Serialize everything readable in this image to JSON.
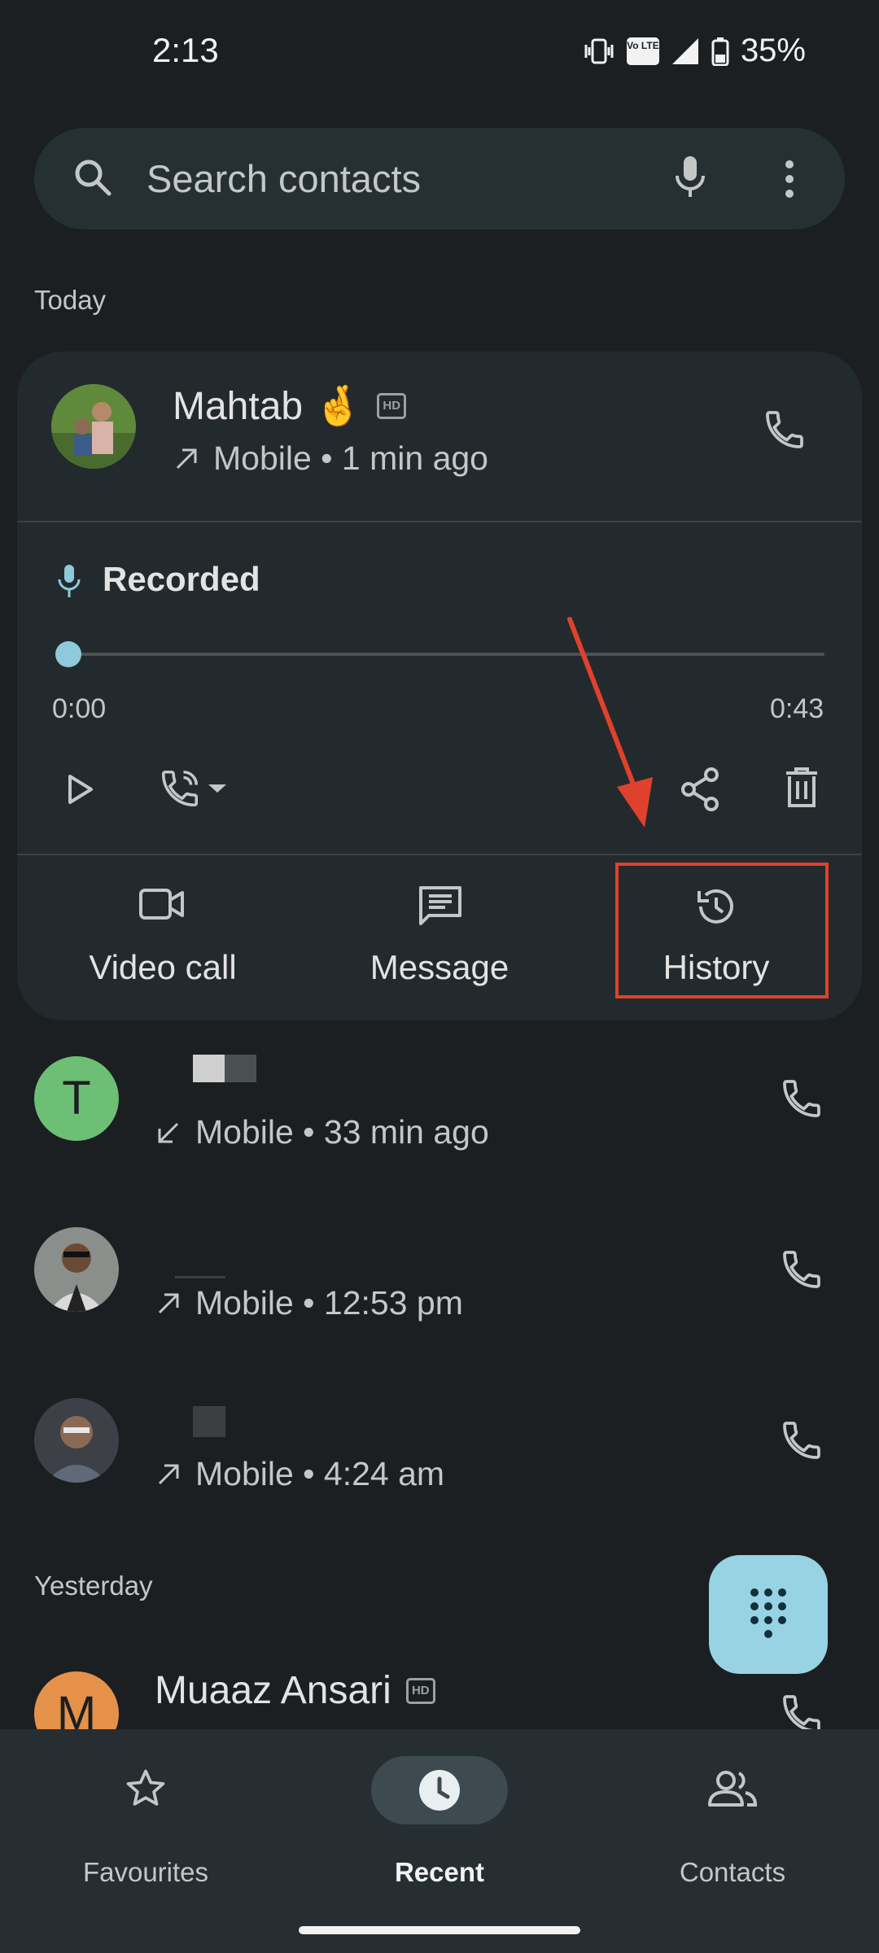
{
  "status_bar": {
    "time": "2:13",
    "network_badge": "Vo LTE",
    "battery": "35%"
  },
  "search": {
    "placeholder": "Search contacts"
  },
  "sections": {
    "today": "Today",
    "yesterday": "Yesterday"
  },
  "expanded_call": {
    "name": "Mahtab 🤞",
    "hd_badge": "HD",
    "detail": "Mobile • 1 min ago",
    "recording": {
      "label": "Recorded",
      "start_time": "0:00",
      "end_time": "0:43",
      "progress": 0
    },
    "actions": {
      "video_call": "Video call",
      "message": "Message",
      "history": "History"
    }
  },
  "calls": [
    {
      "avatar_letter": "T",
      "avatar_color": "#6dbf75",
      "direction": "incoming",
      "detail": "Mobile • 33 min ago"
    },
    {
      "direction": "outgoing",
      "detail": "Mobile • 12:53 pm"
    },
    {
      "direction": "outgoing",
      "detail": "Mobile • 4:24 am"
    }
  ],
  "yesterday_call": {
    "avatar_letter": "M",
    "avatar_color": "#e5914a",
    "name": "Muaaz Ansari",
    "hd_badge": "HD"
  },
  "bottom_nav": {
    "favourites": "Favourites",
    "recent": "Recent",
    "contacts": "Contacts",
    "active": "recent"
  },
  "colors": {
    "background": "#1b1f21",
    "card": "#232a2d",
    "accent": "#98d3e3",
    "highlight": "#e0412c"
  },
  "icons": [
    "vibrate-icon",
    "battery-icon",
    "signal-icon",
    "search-icon",
    "mic-icon",
    "more-icon",
    "phone-icon",
    "outgoing-arrow-icon",
    "incoming-arrow-icon",
    "play-icon",
    "call-audio-route-icon",
    "share-icon",
    "delete-icon",
    "video-camera-icon",
    "message-icon",
    "history-icon",
    "dialpad-icon",
    "star-icon",
    "clock-icon",
    "contacts-icon"
  ]
}
